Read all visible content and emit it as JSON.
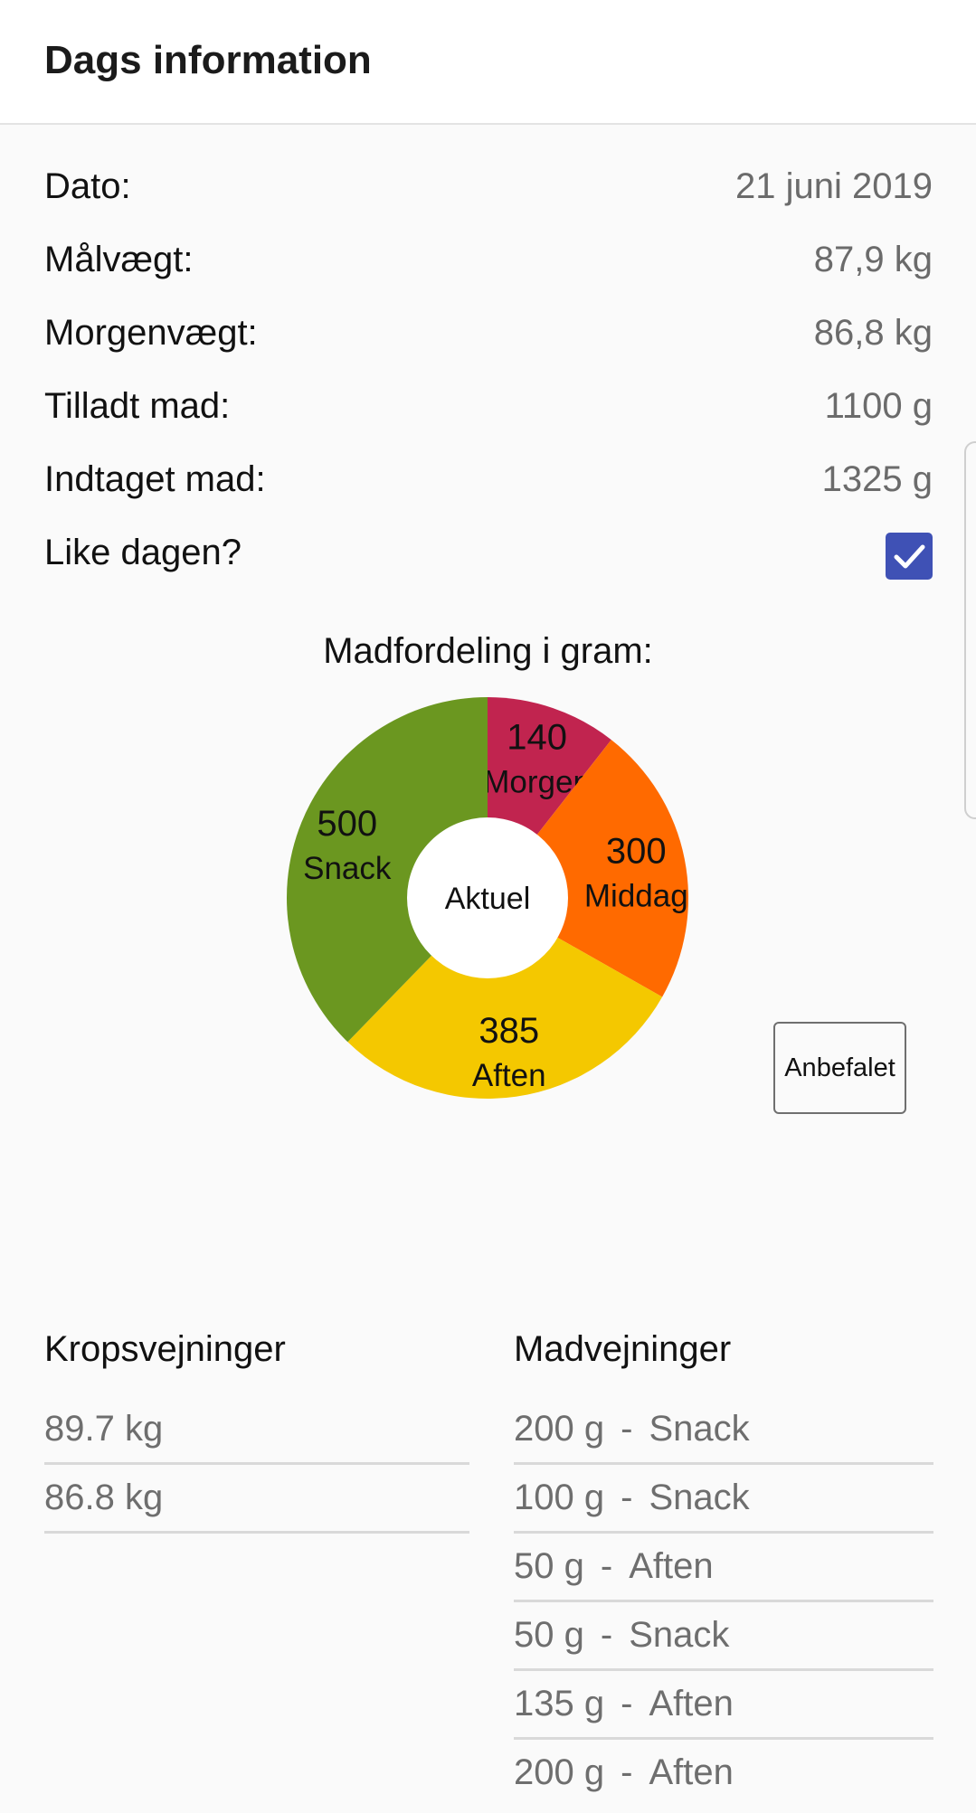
{
  "appbar": {
    "title": "Dags information"
  },
  "info": [
    {
      "label": "Dato:",
      "value": "21 juni 2019"
    },
    {
      "label": "Målvægt:",
      "value": "87,9 kg"
    },
    {
      "label": "Morgenvægt:",
      "value": "86,8 kg"
    },
    {
      "label": "Tilladt mad:",
      "value": "1100 g"
    },
    {
      "label": "Indtaget mad:",
      "value": "1325 g"
    }
  ],
  "like_day": {
    "label": "Like dagen?",
    "checked": true,
    "check_icon": "check-icon"
  },
  "chart_data": {
    "type": "pie",
    "title": "Madfordeling i gram:",
    "center_label": "Aktuel",
    "slices": [
      {
        "label": "Morgen",
        "value": 140,
        "color": "#c1244f"
      },
      {
        "label": "Middag",
        "value": 300,
        "color": "#ff6a00"
      },
      {
        "label": "Aften",
        "value": 385,
        "color": "#f4c800"
      },
      {
        "label": "Snack",
        "value": 500,
        "color": "#6b9720"
      }
    ]
  },
  "recommend_button": {
    "label": "Anbefalet"
  },
  "body_weights": {
    "title": "Kropsvejninger",
    "items": [
      "89.7 kg",
      "86.8 kg"
    ]
  },
  "food_weights": {
    "title": "Madvejninger",
    "items": [
      {
        "amount": "200 g",
        "meal": "Snack"
      },
      {
        "amount": "100 g",
        "meal": "Snack"
      },
      {
        "amount": "50 g",
        "meal": "Aften"
      },
      {
        "amount": "50 g",
        "meal": "Snack"
      },
      {
        "amount": "135 g",
        "meal": "Aften"
      },
      {
        "amount": "200 g",
        "meal": "Aften"
      }
    ]
  }
}
